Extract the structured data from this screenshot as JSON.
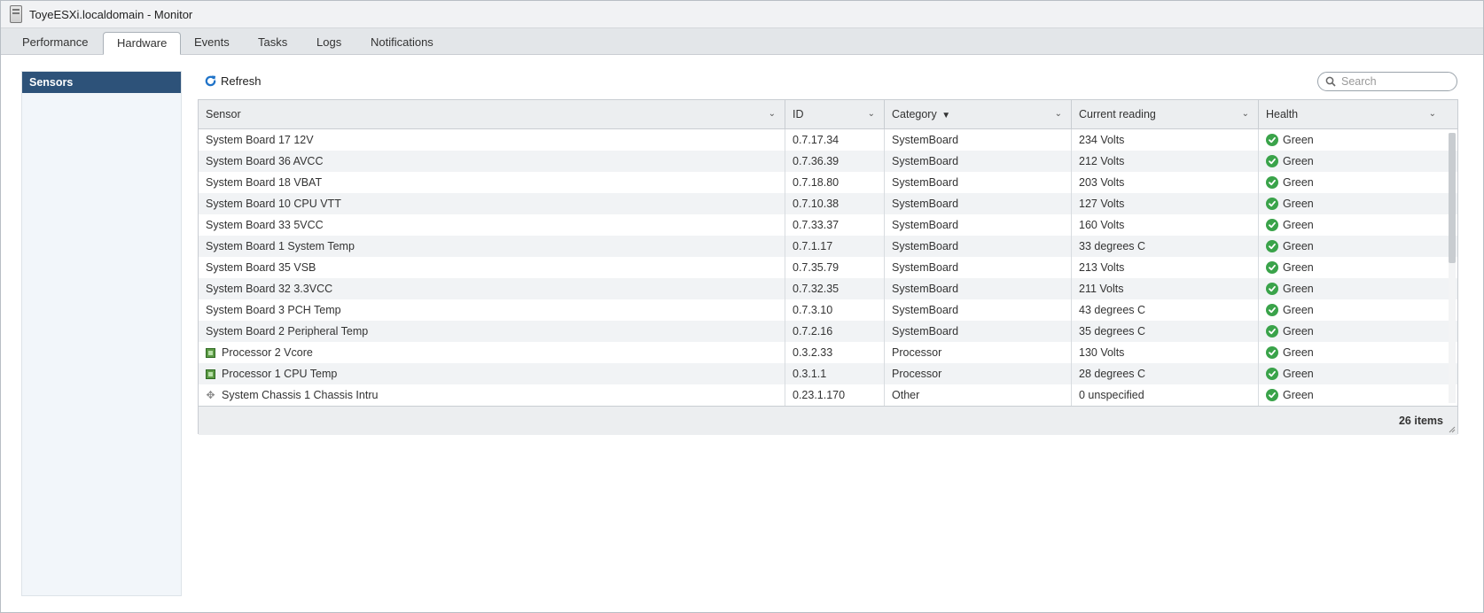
{
  "window": {
    "title": "ToyeESXi.localdomain - Monitor"
  },
  "tabs": [
    {
      "label": "Performance",
      "active": false
    },
    {
      "label": "Hardware",
      "active": true
    },
    {
      "label": "Events",
      "active": false
    },
    {
      "label": "Tasks",
      "active": false
    },
    {
      "label": "Logs",
      "active": false
    },
    {
      "label": "Notifications",
      "active": false
    }
  ],
  "sidebar": {
    "items": [
      {
        "label": "Sensors",
        "selected": true
      }
    ]
  },
  "toolbar": {
    "refresh_label": "Refresh"
  },
  "search": {
    "placeholder": "Search",
    "value": ""
  },
  "table": {
    "columns": [
      {
        "label": "Sensor"
      },
      {
        "label": "ID"
      },
      {
        "label": "Category",
        "sorted": "desc"
      },
      {
        "label": "Current reading"
      },
      {
        "label": "Health"
      }
    ],
    "rows": [
      {
        "sensor": "System Board 17 12V",
        "id": "0.7.17.34",
        "category": "SystemBoard",
        "reading": "234 Volts",
        "health": "Green",
        "icon": "none"
      },
      {
        "sensor": "System Board 36 AVCC",
        "id": "0.7.36.39",
        "category": "SystemBoard",
        "reading": "212 Volts",
        "health": "Green",
        "icon": "none"
      },
      {
        "sensor": "System Board 18 VBAT",
        "id": "0.7.18.80",
        "category": "SystemBoard",
        "reading": "203 Volts",
        "health": "Green",
        "icon": "none"
      },
      {
        "sensor": "System Board 10 CPU VTT",
        "id": "0.7.10.38",
        "category": "SystemBoard",
        "reading": "127 Volts",
        "health": "Green",
        "icon": "none"
      },
      {
        "sensor": "System Board 33 5VCC",
        "id": "0.7.33.37",
        "category": "SystemBoard",
        "reading": "160 Volts",
        "health": "Green",
        "icon": "none"
      },
      {
        "sensor": "System Board 1 System Temp",
        "id": "0.7.1.17",
        "category": "SystemBoard",
        "reading": "33 degrees C",
        "health": "Green",
        "icon": "none"
      },
      {
        "sensor": "System Board 35 VSB",
        "id": "0.7.35.79",
        "category": "SystemBoard",
        "reading": "213 Volts",
        "health": "Green",
        "icon": "none"
      },
      {
        "sensor": "System Board 32 3.3VCC",
        "id": "0.7.32.35",
        "category": "SystemBoard",
        "reading": "211 Volts",
        "health": "Green",
        "icon": "none"
      },
      {
        "sensor": "System Board 3 PCH Temp",
        "id": "0.7.3.10",
        "category": "SystemBoard",
        "reading": "43 degrees C",
        "health": "Green",
        "icon": "none"
      },
      {
        "sensor": "System Board 2 Peripheral Temp",
        "id": "0.7.2.16",
        "category": "SystemBoard",
        "reading": "35 degrees C",
        "health": "Green",
        "icon": "none"
      },
      {
        "sensor": "Processor 2 Vcore",
        "id": "0.3.2.33",
        "category": "Processor",
        "reading": "130 Volts",
        "health": "Green",
        "icon": "processor-icon"
      },
      {
        "sensor": "Processor 1 CPU Temp",
        "id": "0.3.1.1",
        "category": "Processor",
        "reading": "28 degrees C",
        "health": "Green",
        "icon": "processor-icon"
      },
      {
        "sensor": "System Chassis 1 Chassis Intru",
        "id": "0.23.1.170",
        "category": "Other",
        "reading": "0 unspecified",
        "health": "Green",
        "icon": "other-sensor-icon"
      }
    ],
    "footer": {
      "count_label": "26 items"
    }
  },
  "colors": {
    "selection": "#2d5279",
    "health_ok": "#3aa34a"
  }
}
